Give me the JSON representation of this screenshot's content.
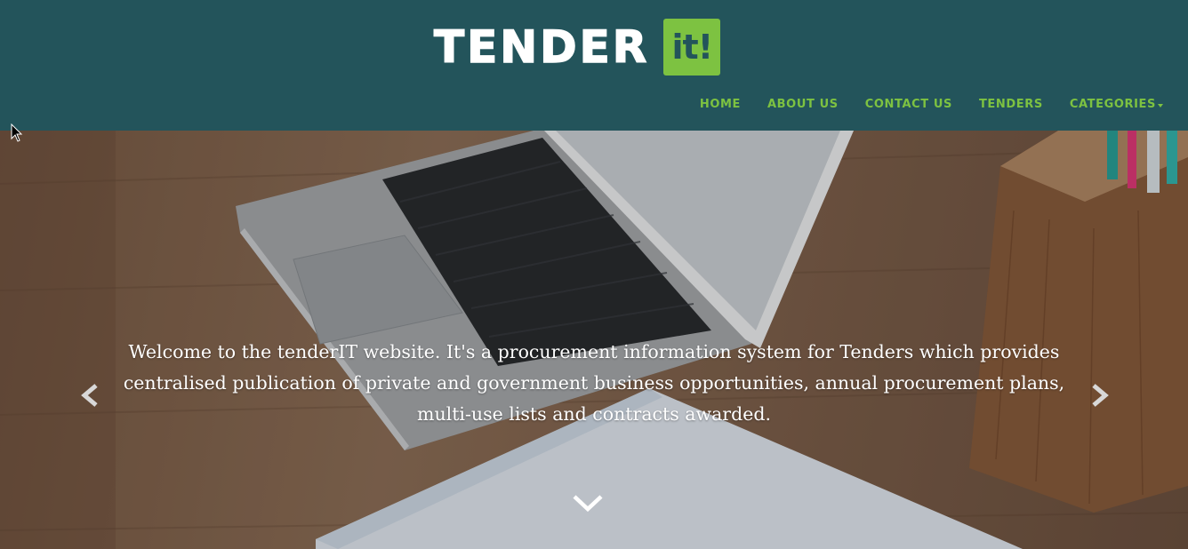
{
  "header": {
    "logo_text": "TENDER",
    "logo_badge": "it!",
    "background": "#23545b",
    "accent": "#7dc241"
  },
  "nav": {
    "items": [
      {
        "label": "HOME"
      },
      {
        "label": "ABOUT US"
      },
      {
        "label": "CONTACT US"
      },
      {
        "label": "TENDERS"
      },
      {
        "label": "CATEGORIES"
      }
    ]
  },
  "hero": {
    "text": "Welcome to the tenderIT website. It's a procurement information system for Tenders which provides centralised publication of private and government business opportunities, annual procurement plans, multi-use lists and contracts awarded.",
    "prev_icon": "chevron-left-icon",
    "next_icon": "chevron-right-icon",
    "scroll_icon": "chevron-down-icon"
  }
}
